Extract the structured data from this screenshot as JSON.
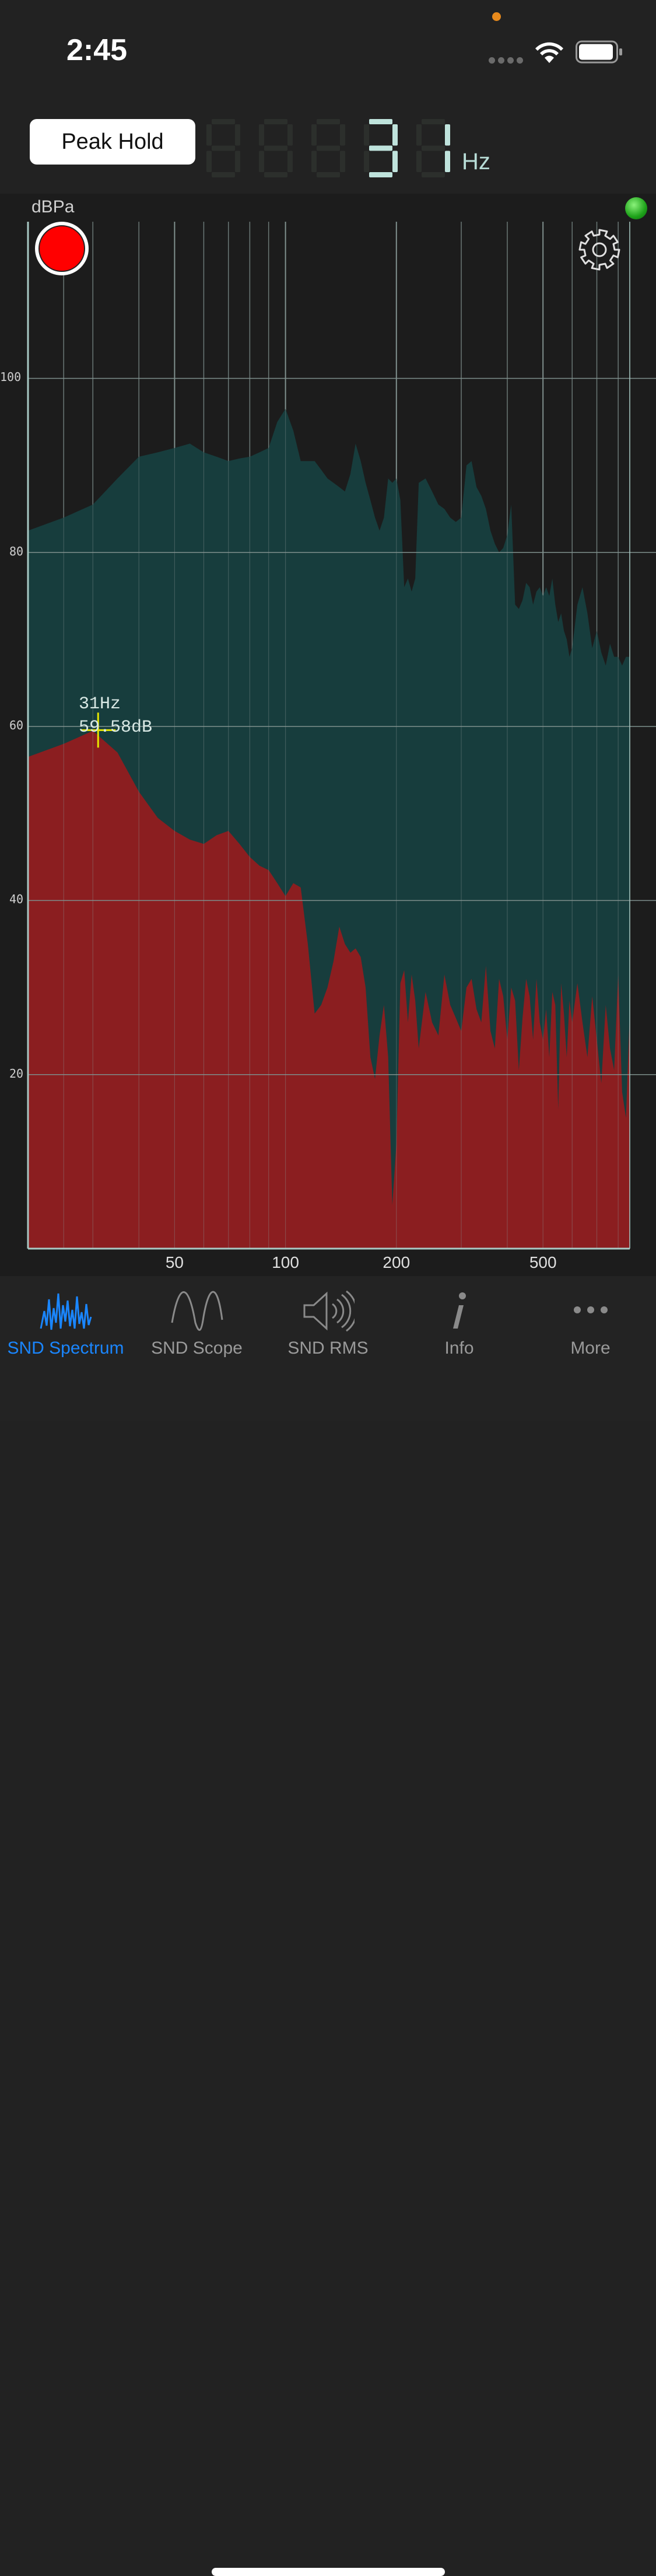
{
  "status_bar": {
    "time": "2:45"
  },
  "header": {
    "peak_hold_label": "Peak Hold",
    "frequency_digits": [
      "",
      "",
      "",
      "3",
      "1"
    ],
    "frequency_unit": "Hz"
  },
  "chart": {
    "unit_label": "dBPa",
    "readout_freq": "31Hz",
    "readout_db": "59.58dB"
  },
  "chart_data": {
    "type": "area",
    "ylabel": "dBPa",
    "xscale": "log",
    "xlim": [
      20,
      860
    ],
    "ylim": [
      0,
      118
    ],
    "grid": true,
    "x_tick_labels": [
      "50",
      "100",
      "200",
      "500"
    ],
    "y_tick_labels": [
      "20",
      "40",
      "60",
      "80",
      "100"
    ],
    "x_ticks": [
      50,
      100,
      200,
      500
    ],
    "y_ticks": [
      20,
      40,
      60,
      80,
      100
    ],
    "minor_x_gridlines": [
      20,
      25,
      30,
      40,
      60,
      70,
      80,
      90,
      300,
      400,
      600,
      700,
      800
    ],
    "cursor": {
      "x": 31,
      "y": 59.58
    },
    "series": [
      {
        "role": "peak-hold",
        "color": "#173d3d",
        "x": [
          20,
          25,
          30,
          35,
          40,
          45,
          50,
          55,
          60,
          65,
          70,
          75,
          80,
          85,
          90,
          95,
          100,
          105,
          110,
          115,
          120,
          125,
          130,
          135,
          140,
          145,
          150,
          155,
          160,
          165,
          170,
          175,
          180,
          185,
          190,
          195,
          200,
          205,
          210,
          215,
          220,
          225,
          230,
          240,
          250,
          260,
          270,
          280,
          290,
          300,
          310,
          320,
          330,
          340,
          350,
          360,
          370,
          380,
          390,
          400,
          410,
          420,
          430,
          440,
          450,
          460,
          470,
          480,
          490,
          500,
          510,
          520,
          530,
          540,
          550,
          560,
          570,
          580,
          590,
          600,
          620,
          640,
          660,
          680,
          700,
          720,
          740,
          760,
          780,
          800,
          820,
          840,
          860
        ],
        "values": [
          82.5,
          84.0,
          85.5,
          88.5,
          91.0,
          91.5,
          92.0,
          92.5,
          91.5,
          91.0,
          90.5,
          90.8,
          91.0,
          91.5,
          92.0,
          95.0,
          96.5,
          94.0,
          90.5,
          90.5,
          90.5,
          89.5,
          88.5,
          88.0,
          87.5,
          87.0,
          89.0,
          92.5,
          90.5,
          88.0,
          86.0,
          84.0,
          82.5,
          84.0,
          88.5,
          88.0,
          88.5,
          86.0,
          76.0,
          77.0,
          75.5,
          77.0,
          88.0,
          88.5,
          87.0,
          85.5,
          85.0,
          84.0,
          83.5,
          84.0,
          90.0,
          90.5,
          87.5,
          86.5,
          85.0,
          82.5,
          81.0,
          80.0,
          80.5,
          82.0,
          85.5,
          74.0,
          73.5,
          74.5,
          76.5,
          76.0,
          74.0,
          75.5,
          76.0,
          75.0,
          76.0,
          75.0,
          77.0,
          74.0,
          72.0,
          73.0,
          71.0,
          70.0,
          68.0,
          69.0,
          74.0,
          76.0,
          73.0,
          69.0,
          71.0,
          68.5,
          67.0,
          69.5,
          68.0,
          68.0,
          67.0,
          68.0,
          68.0
        ]
      },
      {
        "role": "live-spectrum",
        "color": "#8b1e20",
        "x": [
          20,
          25,
          30,
          35,
          40,
          45,
          50,
          55,
          60,
          65,
          70,
          75,
          80,
          85,
          90,
          95,
          100,
          105,
          110,
          115,
          120,
          125,
          130,
          135,
          140,
          145,
          150,
          155,
          160,
          165,
          170,
          175,
          180,
          185,
          190,
          195,
          200,
          205,
          210,
          215,
          220,
          225,
          230,
          240,
          250,
          260,
          270,
          280,
          290,
          300,
          310,
          320,
          330,
          340,
          350,
          360,
          370,
          380,
          390,
          400,
          410,
          420,
          430,
          440,
          450,
          460,
          470,
          480,
          490,
          500,
          510,
          520,
          530,
          540,
          550,
          560,
          570,
          580,
          590,
          600,
          620,
          640,
          660,
          680,
          700,
          720,
          740,
          760,
          780,
          800,
          820,
          840,
          860
        ],
        "values": [
          56.5,
          58.0,
          59.5,
          57.0,
          52.5,
          49.5,
          48.0,
          47.0,
          46.5,
          47.5,
          48.0,
          46.5,
          45.0,
          44.0,
          43.5,
          42.0,
          40.5,
          42.0,
          41.5,
          35.0,
          27.0,
          28.0,
          30.0,
          33.0,
          37.0,
          35.0,
          34.0,
          34.5,
          33.5,
          30.0,
          22.0,
          19.5,
          24.5,
          28.0,
          22.0,
          5.0,
          12.0,
          30.5,
          32.0,
          26.0,
          31.5,
          28.5,
          23.0,
          29.5,
          26.0,
          24.5,
          31.5,
          28.0,
          26.5,
          25.0,
          30.0,
          31.0,
          27.5,
          26.0,
          32.5,
          25.0,
          23.0,
          31.0,
          29.0,
          24.0,
          30.0,
          28.5,
          20.5,
          26.5,
          31.0,
          29.0,
          24.0,
          31.0,
          26.0,
          24.0,
          27.5,
          22.0,
          29.5,
          28.0,
          16.0,
          30.5,
          27.0,
          22.0,
          28.5,
          26.0,
          30.5,
          26.0,
          22.0,
          29.0,
          24.0,
          19.0,
          28.0,
          23.0,
          20.5,
          31.5,
          18.0,
          15.0,
          27.0
        ]
      }
    ]
  },
  "tab_bar": {
    "tabs": [
      {
        "id": "snd-spectrum",
        "label": "SND Spectrum",
        "icon": "spectrum-icon",
        "active": true
      },
      {
        "id": "snd-scope",
        "label": "SND Scope",
        "icon": "sine-wave-icon",
        "active": false
      },
      {
        "id": "snd-rms",
        "label": "SND RMS",
        "icon": "speaker-icon",
        "active": false
      },
      {
        "id": "info",
        "label": "Info",
        "icon": "info-icon",
        "active": false
      },
      {
        "id": "more",
        "label": "More",
        "icon": "more-dots-icon",
        "active": false
      }
    ]
  },
  "colors": {
    "peak_area": "#173d3d",
    "live_area": "#8b1e20",
    "accent": "#1a86ff",
    "cursor": "#e6e600",
    "record": "#ff0000",
    "status_led": "#2ec12a"
  }
}
